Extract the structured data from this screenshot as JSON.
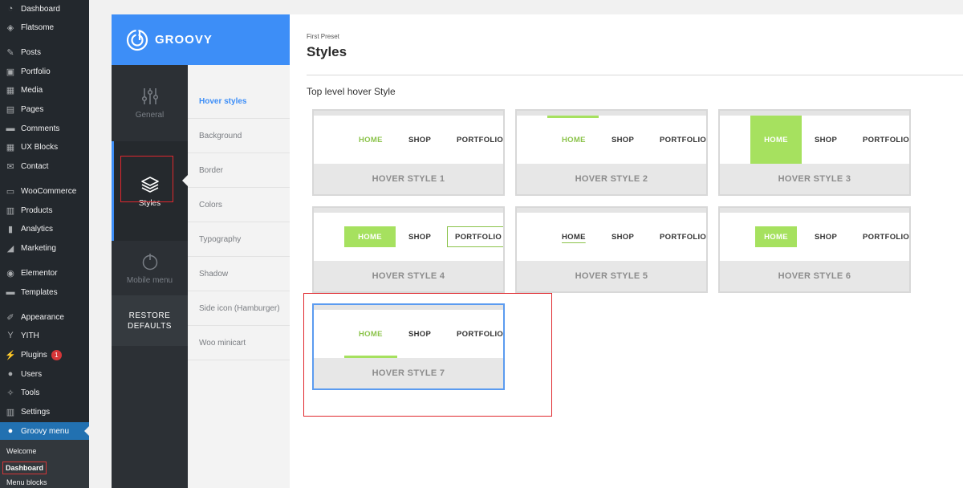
{
  "wp_menu": {
    "items": [
      {
        "label": "Dashboard",
        "icon": "dashboard-icon",
        "glyph": "◔"
      },
      {
        "label": "Flatsome",
        "icon": "flatsome-icon",
        "glyph": "◈"
      },
      {
        "label": "Posts",
        "icon": "pin-icon",
        "glyph": "✎"
      },
      {
        "label": "Portfolio",
        "icon": "portfolio-icon",
        "glyph": "▣"
      },
      {
        "label": "Media",
        "icon": "media-icon",
        "glyph": "▦"
      },
      {
        "label": "Pages",
        "icon": "pages-icon",
        "glyph": "▤"
      },
      {
        "label": "Comments",
        "icon": "comments-icon",
        "glyph": "▬"
      },
      {
        "label": "UX Blocks",
        "icon": "blocks-icon",
        "glyph": "▦"
      },
      {
        "label": "Contact",
        "icon": "mail-icon",
        "glyph": "✉"
      },
      {
        "label": "WooCommerce",
        "icon": "woo-icon",
        "glyph": "▭"
      },
      {
        "label": "Products",
        "icon": "products-icon",
        "glyph": "▥"
      },
      {
        "label": "Analytics",
        "icon": "analytics-icon",
        "glyph": "▮"
      },
      {
        "label": "Marketing",
        "icon": "marketing-icon",
        "glyph": "◢"
      },
      {
        "label": "Elementor",
        "icon": "elementor-icon",
        "glyph": "◉"
      },
      {
        "label": "Templates",
        "icon": "templates-icon",
        "glyph": "▬"
      },
      {
        "label": "Appearance",
        "icon": "brush-icon",
        "glyph": "✐"
      },
      {
        "label": "YITH",
        "icon": "yith-icon",
        "glyph": "Y"
      },
      {
        "label": "Plugins",
        "icon": "plug-icon",
        "glyph": "⚡",
        "badge": "1"
      },
      {
        "label": "Users",
        "icon": "user-icon",
        "glyph": "●"
      },
      {
        "label": "Tools",
        "icon": "wrench-icon",
        "glyph": "✧"
      },
      {
        "label": "Settings",
        "icon": "settings-icon",
        "glyph": "▥"
      },
      {
        "label": "Groovy menu",
        "icon": "groovy-icon",
        "glyph": "●"
      }
    ],
    "submenu": [
      "Welcome",
      "Dashboard",
      "Menu blocks"
    ]
  },
  "groovy": {
    "logo_text": "GROOVY",
    "main_nav": [
      {
        "label": "General",
        "icon": "sliders-icon"
      },
      {
        "label": "Styles",
        "icon": "layers-icon"
      },
      {
        "label": "Mobile menu",
        "icon": "power-icon"
      }
    ],
    "restore": "RESTORE DEFAULTS",
    "sub_nav": [
      "Hover styles",
      "Background",
      "Border",
      "Colors",
      "Typography",
      "Shadow",
      "Side icon (Hamburger)",
      "Woo minicart"
    ]
  },
  "content": {
    "preset": "First Preset",
    "title": "Styles",
    "section": "Top level hover Style",
    "menu_labels": [
      "HOME",
      "SHOP",
      "PORTFOLIO"
    ],
    "cards": [
      "HOVER STYLE 1",
      "HOVER STYLE 2",
      "HOVER STYLE 3",
      "HOVER STYLE 4",
      "HOVER STYLE 5",
      "HOVER STYLE 6",
      "HOVER STYLE 7"
    ],
    "selected_card": "HOVER STYLE 7"
  },
  "colors": {
    "accent_blue": "#3d8ef7",
    "hover_green": "#a6e15f",
    "highlight_red": "#e0282e"
  }
}
